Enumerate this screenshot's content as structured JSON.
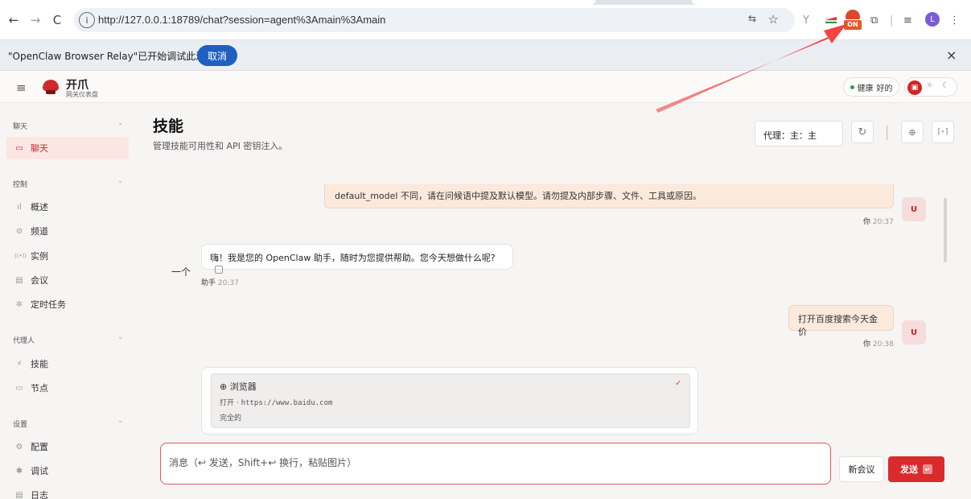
{
  "browser": {
    "url": "http://127.0.0.1:18789/chat?session=agent%3Amain%3Amain",
    "back": "←",
    "forward": "→",
    "reload": "C",
    "info": "i",
    "translate": "⇆",
    "star": "☆",
    "ext_y": "Y",
    "ext_on_label": "ON",
    "ext_puzzle": "⧉",
    "ext_sep": "|",
    "ext_media": "≡",
    "profile": "L",
    "menu": "⋮"
  },
  "infobar": {
    "message": "\"OpenClaw Browser Relay\"已开始调试此浏览器",
    "cancel_label": "取消",
    "close": "×"
  },
  "app": {
    "menu_icon": "≡",
    "brand": "开爪",
    "brand_sub": "网关仪表盘",
    "health_label": "健康",
    "health_value": "好的",
    "mode_icons": [
      "▣",
      "☼",
      "☾"
    ]
  },
  "sidebar": {
    "sections": [
      {
        "title": "聊天",
        "items": [
          {
            "label": "聊天",
            "icon": "▭",
            "active": true
          }
        ]
      },
      {
        "title": "控制",
        "items": [
          {
            "label": "概述",
            "icon": "ıl"
          },
          {
            "label": "频道",
            "icon": "⊘"
          },
          {
            "label": "实例",
            "icon": "((•))"
          },
          {
            "label": "会议",
            "icon": "▤"
          },
          {
            "label": "定时任务",
            "icon": "✲"
          }
        ]
      },
      {
        "title": "代理人",
        "items": [
          {
            "label": "技能",
            "icon": "⚡"
          },
          {
            "label": "节点",
            "icon": "▭"
          }
        ]
      },
      {
        "title": "设置",
        "items": [
          {
            "label": "配置",
            "icon": "⚙"
          },
          {
            "label": "调试",
            "icon": "✱"
          },
          {
            "label": "日志",
            "icon": "▤"
          }
        ]
      }
    ],
    "chevron": "⌄"
  },
  "page": {
    "title": "技能",
    "subtitle": "管理技能可用性和 API 密钥注入。",
    "agent_select": "代理：主：主",
    "refresh_icon": "↻",
    "btn_a": "⊕",
    "btn_b": "[∘]"
  },
  "chat": {
    "msg1_text": "default_model 不同，请在问候语中提及默认模型。请勿提及内部步骤、文件、工具或原因。",
    "msg1_author": "你",
    "msg1_time": "20:37",
    "user_badge": "U",
    "asst_lead": "一个",
    "msg2_text": "嗨！我是您的 OpenClaw 助手，随时为您提供帮助。您今天想做什么呢?",
    "msg2_author": "助手",
    "msg2_time": "20:37",
    "msg3_text": "打开百度搜索今天金价",
    "msg3_author": "你",
    "msg3_time": "20:38",
    "tool": {
      "icon": "⊕",
      "name": "浏览器",
      "check": "✓",
      "action": "打开",
      "dot": "·",
      "url": "https://www.baidu.com",
      "status": "完全的"
    }
  },
  "composer": {
    "placeholder": "消息（↩ 发送，Shift+↩ 换行，粘贴图片）",
    "new_session": "新会议",
    "send": "发送",
    "send_key": "↵"
  }
}
